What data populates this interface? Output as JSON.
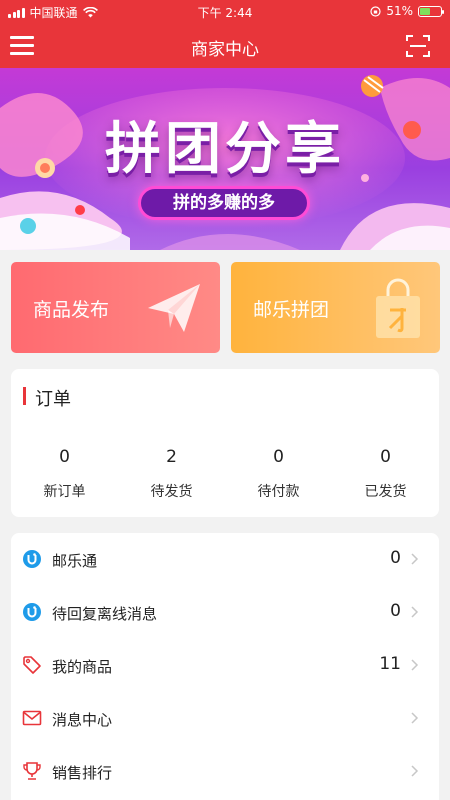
{
  "status_bar": {
    "carrier": "中国联通",
    "time": "下午 2:44",
    "battery": "51%"
  },
  "nav": {
    "title": "商家中心",
    "menu_icon": "hamburger-menu-icon",
    "scan_icon": "scan-icon"
  },
  "banner": {
    "title": "拼团分享",
    "subtitle": "拼的多赚的多"
  },
  "quick_actions": [
    {
      "label": "商品发布",
      "icon": "paper-plane-icon",
      "color": "#ff6a70"
    },
    {
      "label": "邮乐拼团",
      "icon": "shopping-bag-icon",
      "color": "#ffb33d"
    }
  ],
  "orders": {
    "title": "订单",
    "items": [
      {
        "label": "新订单",
        "count": "0"
      },
      {
        "label": "待发货",
        "count": "2"
      },
      {
        "label": "待付款",
        "count": "0"
      },
      {
        "label": "已发货",
        "count": "0"
      }
    ]
  },
  "menu_list": [
    {
      "label": "邮乐通",
      "count": "0",
      "icon": "youle-chat-icon"
    },
    {
      "label": "待回复离线消息",
      "count": "0",
      "icon": "youle-chat-icon"
    },
    {
      "label": "我的商品",
      "count": "11",
      "icon": "tag-icon"
    },
    {
      "label": "消息中心",
      "count": "",
      "icon": "mail-icon"
    },
    {
      "label": "销售排行",
      "count": "",
      "icon": "trophy-icon"
    }
  ],
  "colors": {
    "brand_red": "#e8353a",
    "accent_blue": "#1e9be9"
  }
}
